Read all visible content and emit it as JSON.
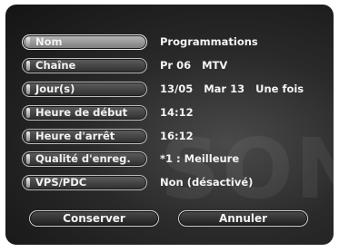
{
  "watermark": "SONY",
  "fields": [
    {
      "label": "Nom",
      "value": "Programmations",
      "selected": true
    },
    {
      "label": "Chaîne",
      "value": "Pr 06   MTV",
      "selected": false
    },
    {
      "label": "Jour(s)",
      "value": "13/05   Mar 13   Une fois",
      "selected": false
    },
    {
      "label": "Heure de début",
      "value": "14:12",
      "selected": false
    },
    {
      "label": "Heure d'arrêt",
      "value": "16:12",
      "selected": false
    },
    {
      "label": "Qualité d'enreg.",
      "value": "*1 : Meilleure",
      "selected": false
    },
    {
      "label": "VPS/PDC",
      "value": "Non (désactivé)",
      "selected": false
    }
  ],
  "actions": {
    "save_label": "Conserver",
    "cancel_label": "Annuler"
  }
}
